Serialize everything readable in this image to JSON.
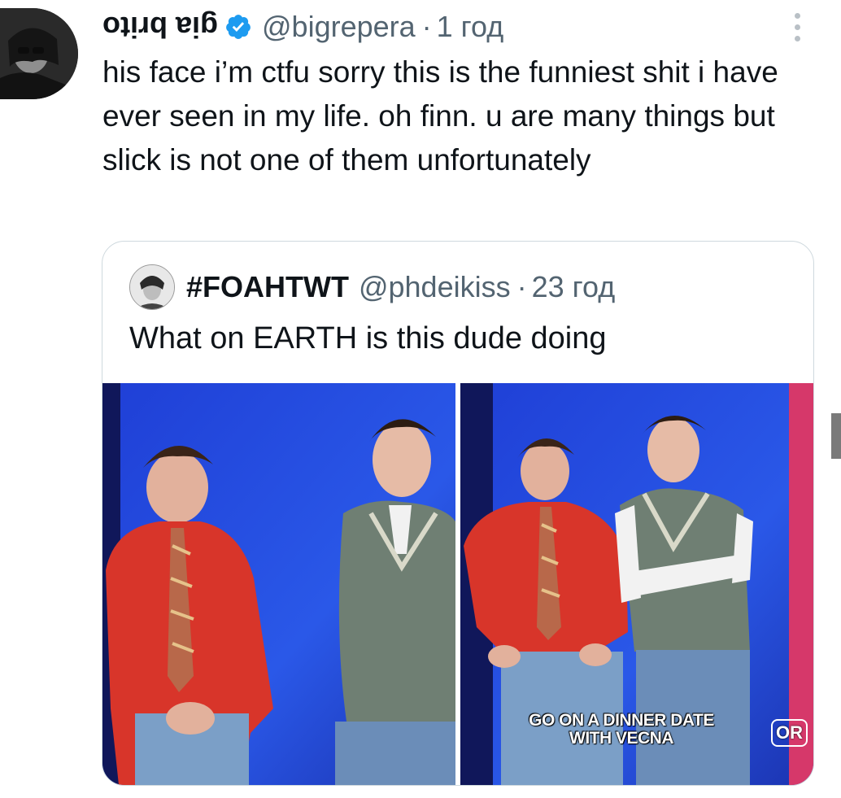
{
  "tweet": {
    "display_name": "gia brito",
    "handle": "@bigrepera",
    "separator": "·",
    "time": "1 год",
    "text": "his face i’m ctfu sorry this is the funniest shit i have ever seen in my life. oh finn. u are many things but slick is not one of them unfortunately",
    "icons": {
      "verified": "verified-badge-icon",
      "more": "more-options-icon"
    },
    "colors": {
      "verified": "#1d9bf0",
      "secondary_text": "#536471",
      "border": "#cfd9de"
    }
  },
  "quote": {
    "display_name": "#FOAHTWT",
    "handle": "@phdeikiss",
    "separator": "·",
    "time": "23 год",
    "text": "What on EARTH is this dude doing",
    "media": {
      "caption": "GO ON A DINNER DATE WITH VECNA",
      "corner_badge": "OR"
    }
  }
}
